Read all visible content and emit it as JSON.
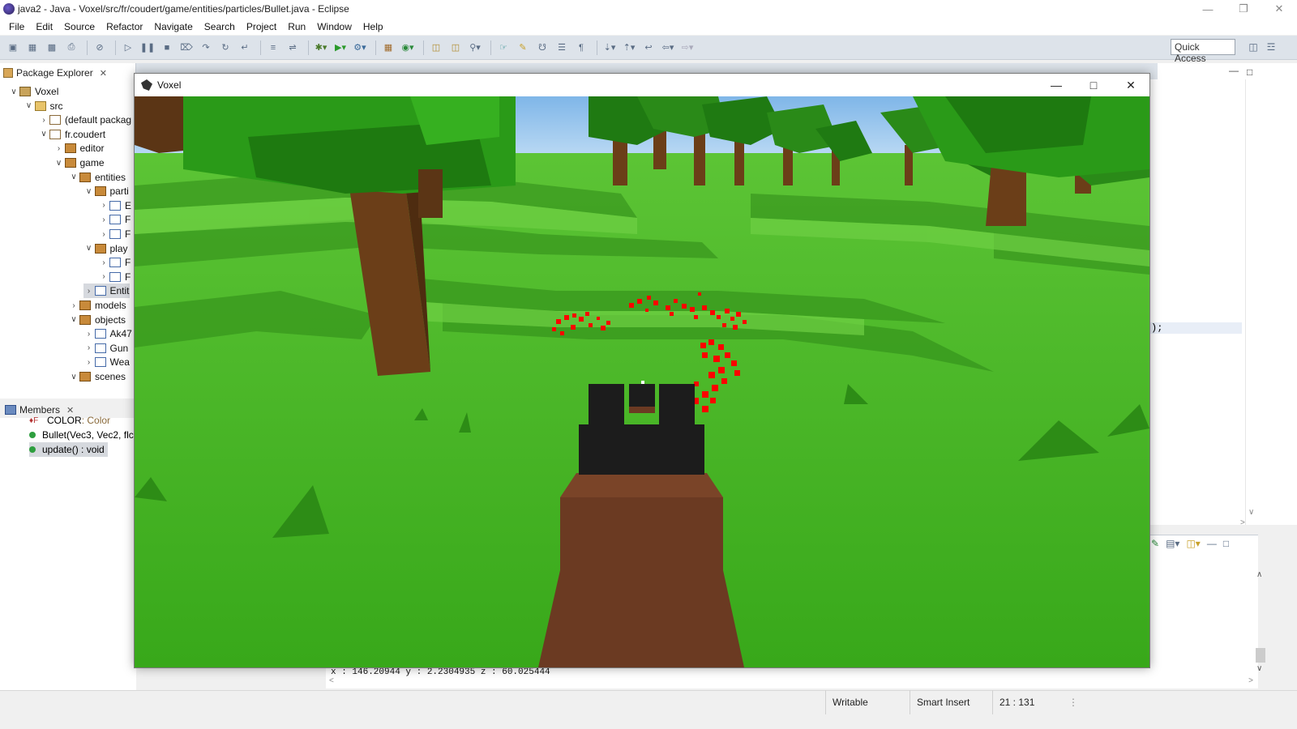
{
  "window": {
    "title": "java2 - Java - Voxel/src/fr/coudert/game/entities/particles/Bullet.java - Eclipse"
  },
  "menu": [
    "File",
    "Edit",
    "Source",
    "Refactor",
    "Navigate",
    "Search",
    "Project",
    "Run",
    "Window",
    "Help"
  ],
  "toolbar": {
    "quick_access": "Quick Access"
  },
  "package_explorer": {
    "tab_label": "Package Explorer",
    "tree": [
      {
        "label": "Voxel",
        "depth": 0,
        "expanded": true,
        "icon": "project-icon"
      },
      {
        "label": "src",
        "depth": 1,
        "expanded": true,
        "icon": "source-folder-icon"
      },
      {
        "label": "(default packag",
        "depth": 2,
        "expanded": false,
        "icon": "package-empty-icon"
      },
      {
        "label": "fr.coudert",
        "depth": 2,
        "expanded": true,
        "icon": "package-empty-icon"
      },
      {
        "label": "editor",
        "depth": 3,
        "expanded": false,
        "icon": "package-icon"
      },
      {
        "label": "game",
        "depth": 3,
        "expanded": true,
        "icon": "package-icon"
      },
      {
        "label": "entities",
        "depth": 4,
        "expanded": true,
        "icon": "package-icon"
      },
      {
        "label": "parti",
        "depth": 5,
        "expanded": true,
        "icon": "package-icon"
      },
      {
        "label": "E",
        "depth": 6,
        "expanded": false,
        "icon": "java-file-icon"
      },
      {
        "label": "F",
        "depth": 6,
        "expanded": false,
        "icon": "java-file-icon"
      },
      {
        "label": "F",
        "depth": 6,
        "expanded": false,
        "icon": "java-file-icon"
      },
      {
        "label": "play",
        "depth": 5,
        "expanded": true,
        "icon": "package-icon"
      },
      {
        "label": "F",
        "depth": 6,
        "expanded": false,
        "icon": "java-file-icon"
      },
      {
        "label": "F",
        "depth": 6,
        "expanded": false,
        "icon": "java-file-icon"
      },
      {
        "label": "Entit",
        "depth": 5,
        "expanded": false,
        "icon": "java-file-icon",
        "selected": true
      },
      {
        "label": "models",
        "depth": 4,
        "expanded": false,
        "icon": "package-icon"
      },
      {
        "label": "objects",
        "depth": 4,
        "expanded": true,
        "icon": "package-icon"
      },
      {
        "label": "Ak47",
        "depth": 5,
        "expanded": false,
        "icon": "java-file-icon"
      },
      {
        "label": "Gun",
        "depth": 5,
        "expanded": false,
        "icon": "java-file-icon"
      },
      {
        "label": "Wea",
        "depth": 5,
        "expanded": false,
        "icon": "java-file-icon"
      },
      {
        "label": "scenes",
        "depth": 4,
        "expanded": true,
        "icon": "package-icon"
      }
    ]
  },
  "members": {
    "tab_label": "Members",
    "items": [
      {
        "name": "COLOR",
        "type": " : Color",
        "kind": "field"
      },
      {
        "name": "Bullet(Vec3, Vec2, flc",
        "type": "",
        "kind": "constructor"
      },
      {
        "name": "update() : void",
        "type": "",
        "kind": "method",
        "selected": true
      }
    ]
  },
  "editor": {
    "visible_code": ");"
  },
  "console": {
    "output": "x : 146.20944 y : 2.2304935 z : 60.025444"
  },
  "status_bar": {
    "writable": "Writable",
    "insert_mode": "Smart Insert",
    "position": "21 : 131"
  },
  "game_window": {
    "title": "Voxel"
  },
  "colors": {
    "toolbar_bg": "#dde3ea",
    "grass": "#3fae1f",
    "blood": "#ff0000",
    "gun_body": "#1c1c1c",
    "gun_stock": "#6b3a22"
  }
}
